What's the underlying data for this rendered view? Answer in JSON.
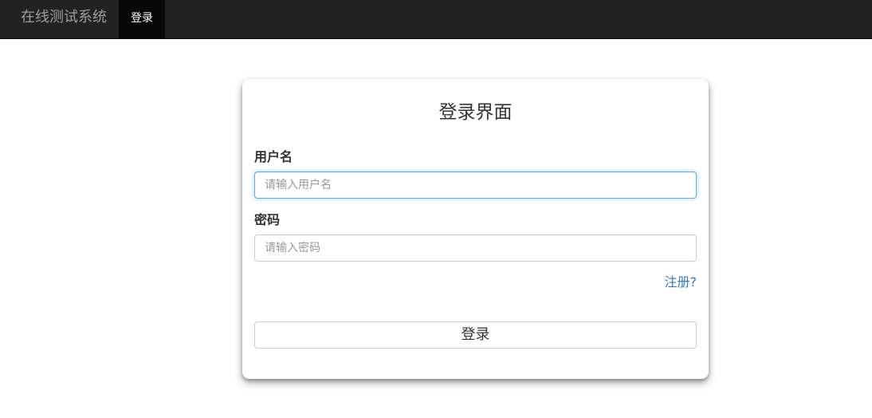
{
  "navbar": {
    "brand": "在线测试系统",
    "active_item": "登录"
  },
  "login_panel": {
    "title": "登录界面",
    "username_label": "用户名",
    "username_placeholder": "请输入用户名",
    "username_value": "",
    "password_label": "密码",
    "password_placeholder": "请输入密码",
    "password_value": "",
    "register_link": "注册?",
    "submit_label": "登录"
  },
  "colors": {
    "navbar_bg": "#222222",
    "nav_active_bg": "#080808",
    "link": "#337ab7",
    "focus_border": "#66afe9"
  }
}
